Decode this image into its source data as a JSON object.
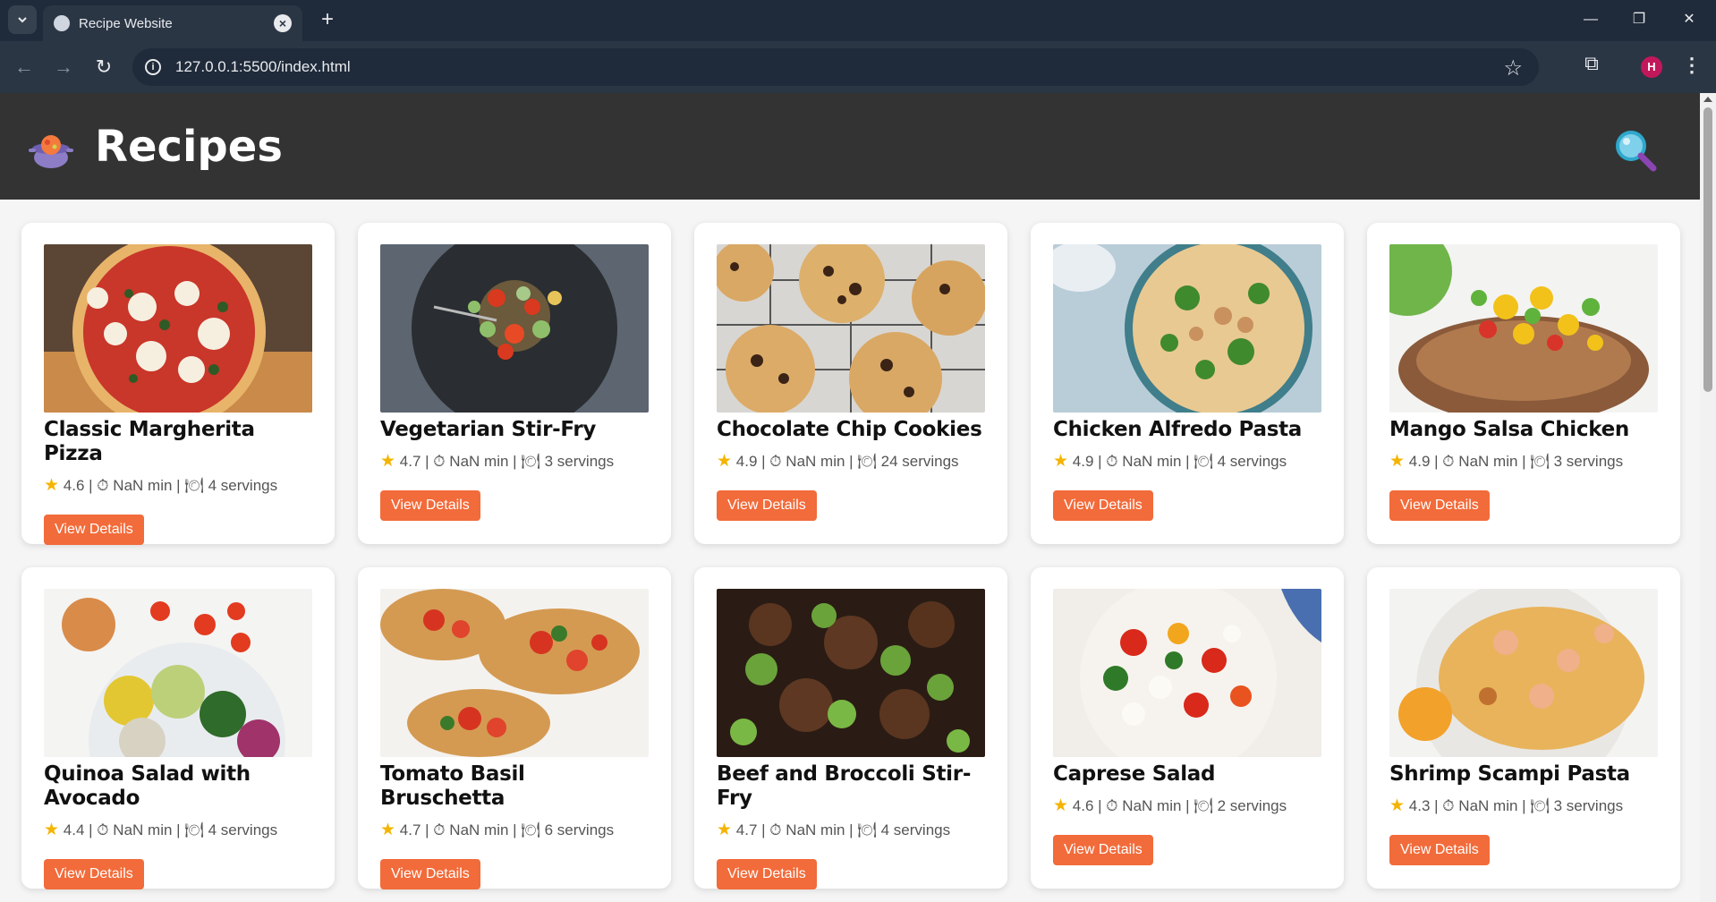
{
  "browser": {
    "tab_title": "Recipe Website",
    "url": "127.0.0.1:5500/index.html",
    "profile_initial": "H"
  },
  "header": {
    "title": "Recipes"
  },
  "recipes": [
    {
      "title": "Classic Margherita Pizza",
      "rating": "4.6",
      "time": "NaN min",
      "servings": "4 servings",
      "button": "View Details",
      "image": "pizza"
    },
    {
      "title": "Vegetarian Stir-Fry",
      "rating": "4.7",
      "time": "NaN min",
      "servings": "3 servings",
      "button": "View Details",
      "image": "stirfry"
    },
    {
      "title": "Chocolate Chip Cookies",
      "rating": "4.9",
      "time": "NaN min",
      "servings": "24 servings",
      "button": "View Details",
      "image": "cookies"
    },
    {
      "title": "Chicken Alfredo Pasta",
      "rating": "4.9",
      "time": "NaN min",
      "servings": "4 servings",
      "button": "View Details",
      "image": "alfredo"
    },
    {
      "title": "Mango Salsa Chicken",
      "rating": "4.9",
      "time": "NaN min",
      "servings": "3 servings",
      "button": "View Details",
      "image": "mango"
    },
    {
      "title": "Quinoa Salad with Avocado",
      "rating": "4.4",
      "time": "NaN min",
      "servings": "4 servings",
      "button": "View Details",
      "image": "quinoa"
    },
    {
      "title": "Tomato Basil Bruschetta",
      "rating": "4.7",
      "time": "NaN min",
      "servings": "6 servings",
      "button": "View Details",
      "image": "bruschetta"
    },
    {
      "title": "Beef and Broccoli Stir-Fry",
      "rating": "4.7",
      "time": "NaN min",
      "servings": "4 servings",
      "button": "View Details",
      "image": "beef"
    },
    {
      "title": "Caprese Salad",
      "rating": "4.6",
      "time": "NaN min",
      "servings": "2 servings",
      "button": "View Details",
      "image": "caprese"
    },
    {
      "title": "Shrimp Scampi Pasta",
      "rating": "4.3",
      "time": "NaN min",
      "servings": "3 servings",
      "button": "View Details",
      "image": "shrimp"
    }
  ],
  "colors": {
    "accent": "#f26b3a",
    "header_bg": "#333333",
    "star": "#f4b400"
  }
}
